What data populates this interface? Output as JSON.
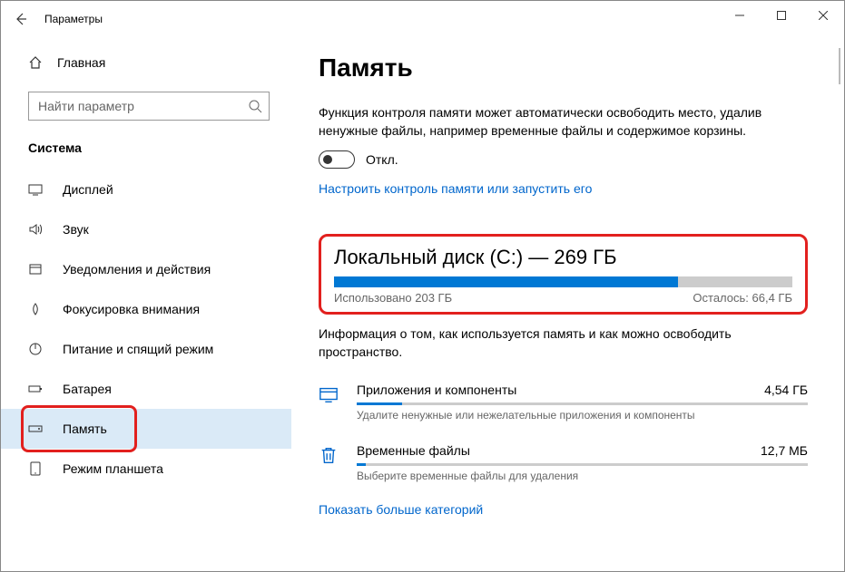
{
  "window": {
    "title": "Параметры"
  },
  "sidebar": {
    "home": "Главная",
    "search_placeholder": "Найти параметр",
    "group": "Система",
    "items": [
      {
        "label": "Дисплей"
      },
      {
        "label": "Звук"
      },
      {
        "label": "Уведомления и действия"
      },
      {
        "label": "Фокусировка внимания"
      },
      {
        "label": "Питание и спящий режим"
      },
      {
        "label": "Батарея"
      },
      {
        "label": "Память"
      },
      {
        "label": "Режим планшета"
      }
    ]
  },
  "main": {
    "heading": "Память",
    "description": "Функция контроля памяти может автоматически освободить место, удалив ненужные файлы, например временные файлы и содержимое корзины.",
    "toggle_label": "Откл.",
    "configure_link": "Настроить контроль памяти или запустить его",
    "disk": {
      "title": "Локальный диск (C:) — 269 ГБ",
      "used_label": "Использовано 203 ГБ",
      "free_label": "Осталось: 66,4 ГБ",
      "fill_percent": 75
    },
    "info": "Информация о том, как используется память и как можно освободить пространство.",
    "categories": [
      {
        "name": "Приложения и компоненты",
        "size": "4,54 ГБ",
        "sub": "Удалите ненужные или нежелательные приложения и компоненты",
        "fill": 10
      },
      {
        "name": "Временные файлы",
        "size": "12,7 МБ",
        "sub": "Выберите временные файлы для удаления",
        "fill": 2
      }
    ],
    "show_more": "Показать больше категорий"
  }
}
